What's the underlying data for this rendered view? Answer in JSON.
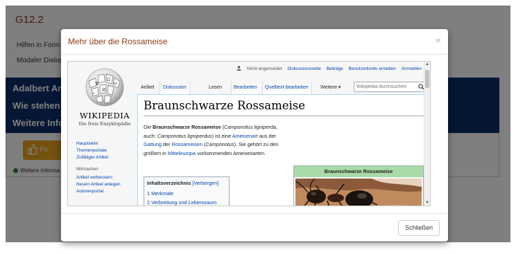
{
  "background_page": {
    "title": "G12.2",
    "line1": "Hilfen in Form",
    "line2": "Modaler Dialog",
    "blue_lines": [
      "Adalbert Am",
      "Wie stehen S",
      "Weitere Info"
    ],
    "orange_button": "Po",
    "note": "Weitere Informa"
  },
  "modal": {
    "title": "Mehr über die Rossameise",
    "close_symbol": "×",
    "close_button": "Schließen"
  },
  "wiki": {
    "wordmark": "WIKIPEDIA",
    "tagline": "Die freie Enzyklopädie",
    "sidebar": {
      "main_links": [
        "Hauptseite",
        "Themenportale",
        "Zufälliger Artikel"
      ],
      "section_head": "Mitmachen",
      "section_links": [
        "Artikel verbessern",
        "Neuen Artikel anlegen",
        "Autorenportal"
      ]
    },
    "personal": {
      "not_logged_in": "Nicht angemeldet",
      "links": [
        "Diskussionsseite",
        "Beiträge",
        "Benutzerkonto erstellen",
        "Anmelden"
      ]
    },
    "tabs": {
      "article": "Artikel",
      "discussion": "Diskussion",
      "read": "Lesen",
      "edit": "Bearbeiten",
      "edit_source": "Quelltext bearbeiten",
      "more": "Weitere ▾"
    },
    "search_placeholder": "Wikipedia durchsuchen",
    "article": {
      "title": "Braunschwarze Rossameise",
      "intro": {
        "t1": "Die ",
        "bold": "Braunschwarze Rossameise",
        "t2": " (",
        "italic1": "Camponotus ligniperda",
        "t3": ", auch: ",
        "italic2": "Camponotus ligniperdus",
        "t4": ") ist eine ",
        "link1": "Ameisenart",
        "t5": " aus der ",
        "link2": "Gattung",
        "t6": " der ",
        "link3": "Rossameisen",
        "t7": " (",
        "italic3": "Camponotus",
        "t8": "). Sie gehört zu den größten in ",
        "link4": "Mitteleuropa",
        "t9": " vorkommenden Ameisenarten."
      },
      "toc": {
        "title": "Inhaltsverzeichnis",
        "toggle": "[Verbergen]",
        "items": [
          "1  Merkmale",
          "2  Verbreitung und Lebensraum"
        ]
      },
      "infobox_title": "Braunschwarze Rossameise"
    }
  }
}
